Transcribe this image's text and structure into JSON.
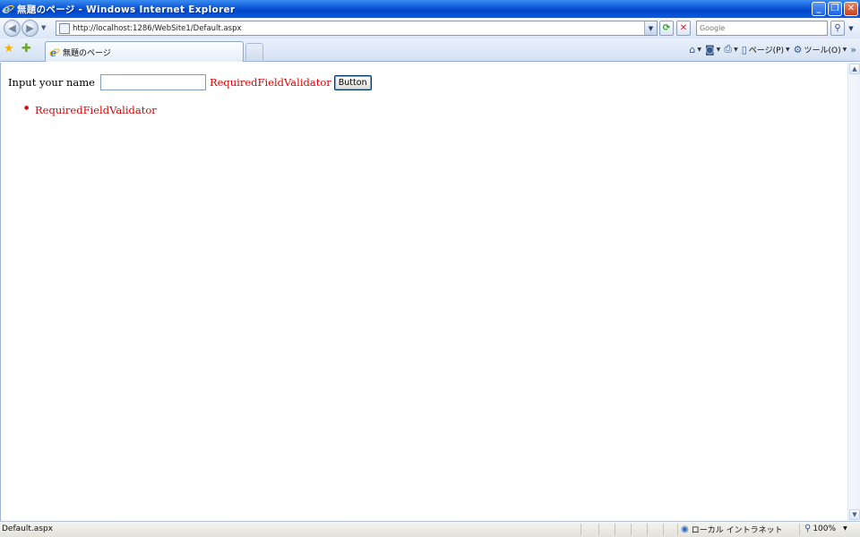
{
  "window": {
    "title": "無題のページ - Windows Internet Explorer",
    "minimize_glyph": "_",
    "maximize_glyph": "❐",
    "close_glyph": "✕"
  },
  "navigation": {
    "url": "http://localhost:1286/WebSite1/Default.aspx",
    "search_placeholder": "Google"
  },
  "tabs": [
    {
      "label": "無題のページ",
      "active": true
    }
  ],
  "command_bar": {
    "page_label": "ページ(P)",
    "tools_label": "ツール(O)"
  },
  "page": {
    "form": {
      "label": "Input your name",
      "input_value": "",
      "validator_text": "RequiredFieldValidator",
      "button_label": "Button"
    },
    "validation_summary": [
      "RequiredFieldValidator"
    ]
  },
  "status_bar": {
    "text": "Default.aspx",
    "zone": "ローカル イントラネット",
    "zoom": "100%"
  },
  "colors": {
    "titlebar": "#0b55d8",
    "error": "#e00000"
  }
}
